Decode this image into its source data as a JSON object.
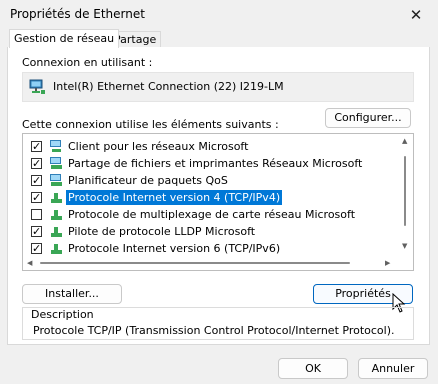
{
  "window": {
    "title": "Propriétés de Ethernet",
    "close_label": "✕"
  },
  "tabs": [
    {
      "label": "Gestion de réseau"
    },
    {
      "label": "Partage"
    }
  ],
  "connection": {
    "label": "Connexion en utilisant :",
    "adapter": "Intel(R) Ethernet Connection (22) I219-LM",
    "configure_label": "Configurer..."
  },
  "components": {
    "label": "Cette connexion utilise les éléments suivants :",
    "items": [
      {
        "label": "Client pour les réseaux Microsoft",
        "checked": true,
        "icon": "network-client-icon"
      },
      {
        "label": "Partage de fichiers et imprimantes Réseaux Microsoft",
        "checked": true,
        "icon": "network-service-icon"
      },
      {
        "label": "Planificateur de paquets QoS",
        "checked": true,
        "icon": "network-service-icon"
      },
      {
        "label": "Protocole Internet version 4 (TCP/IPv4)",
        "checked": true,
        "icon": "protocol-icon",
        "selected": true
      },
      {
        "label": "Protocole de multiplexage de carte réseau Microsoft",
        "checked": false,
        "icon": "protocol-icon"
      },
      {
        "label": "Pilote de protocole LLDP Microsoft",
        "checked": true,
        "icon": "protocol-icon"
      },
      {
        "label": "Protocole Internet version 6 (TCP/IPv6)",
        "checked": true,
        "icon": "protocol-icon"
      }
    ]
  },
  "actions": {
    "install_label": "Installer...",
    "properties_label": "Propriétés"
  },
  "description": {
    "legend": "Description",
    "text": "Protocole TCP/IP (Transmission Control Protocol/Internet Protocol)."
  },
  "footer": {
    "ok_label": "OK",
    "cancel_label": "Annuler"
  },
  "colors": {
    "selection": "#0078d7",
    "accent_border": "#0067c0"
  }
}
